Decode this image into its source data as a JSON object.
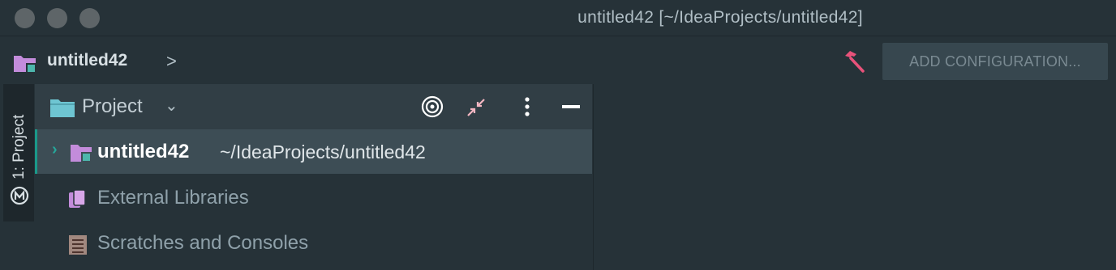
{
  "window": {
    "title": "untitled42 [~/IdeaProjects/untitled42]"
  },
  "navbar": {
    "project_name": "untitled42",
    "chevron": ">",
    "build_icon": "hammer-icon",
    "add_configuration_label": "ADD CONFIGURATION..."
  },
  "tool_strip": {
    "project_tab_label": "1: Project"
  },
  "project_panel": {
    "title": "Project",
    "dropdown_chevron": "⌄",
    "icons": [
      "locate-target-icon",
      "collapse-all-icon",
      "more-options-icon",
      "minimize-icon"
    ],
    "tree": [
      {
        "name": "untitled42",
        "path": "~/IdeaProjects/untitled42",
        "icon": "module-folder-icon",
        "selected": true
      },
      {
        "label": "External Libraries",
        "icon": "libraries-icon"
      },
      {
        "label": "Scratches and Consoles",
        "icon": "scratches-icon"
      }
    ]
  },
  "colors": {
    "background": "#263238",
    "panel_header": "#313e45",
    "selection": "#3d4d55",
    "accent_teal": "#26a69a",
    "folder_purple": "#c38cdb",
    "hammer_pink": "#e8527a"
  }
}
